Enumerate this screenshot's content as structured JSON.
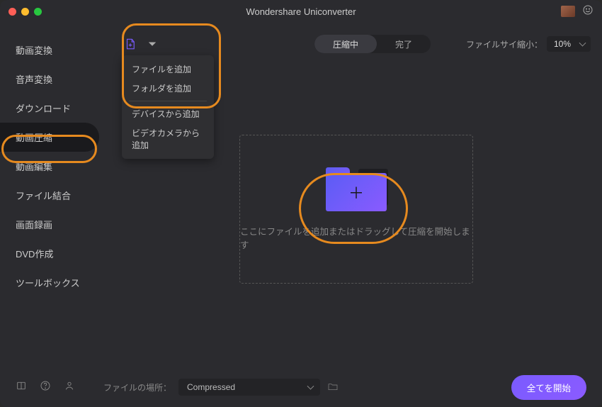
{
  "title": "Wondershare Uniconverter",
  "sidebar": {
    "items": [
      {
        "label": "動画変換"
      },
      {
        "label": "音声変換"
      },
      {
        "label": "ダウンロード"
      },
      {
        "label": "動画圧縮"
      },
      {
        "label": "動画編集"
      },
      {
        "label": "ファイル結合"
      },
      {
        "label": "画面録画"
      },
      {
        "label": "DVD作成"
      },
      {
        "label": "ツールボックス"
      }
    ]
  },
  "dropdown": {
    "items": [
      {
        "label": "ファイルを追加"
      },
      {
        "label": "フォルダを追加"
      }
    ],
    "items2": [
      {
        "label": "デバイスから追加"
      },
      {
        "label": "ビデオカメラから追加"
      }
    ]
  },
  "tabs": {
    "compressing": "圧縮中",
    "done": "完了"
  },
  "reduce": {
    "label": "ファイルサイ縮小：",
    "value": "10%"
  },
  "dropzone": {
    "text": "ここにファイルを追加またはドラッグして圧縮を開始します"
  },
  "bottom": {
    "location_label": "ファイルの場所：",
    "location_value": "Compressed",
    "start": "全てを開始"
  }
}
